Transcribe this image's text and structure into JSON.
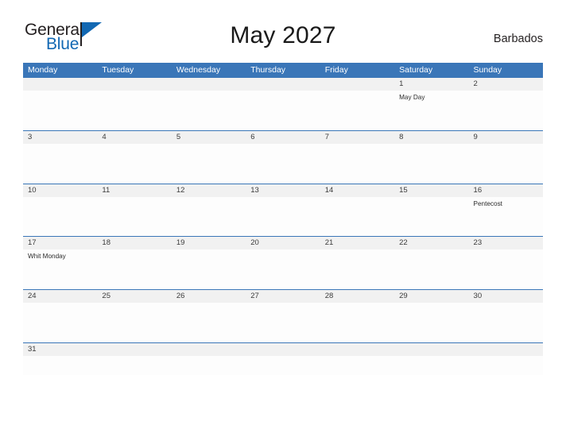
{
  "brand": {
    "name_top": "General",
    "name_bottom": "Blue",
    "flag_icon": "flag-triangle-icon",
    "color_primary": "#1268b3",
    "color_text": "#231f20"
  },
  "header": {
    "title": "May 2027",
    "country": "Barbados"
  },
  "calendar": {
    "header_bg": "#3a76b8",
    "date_strip_bg": "#f1f1f1",
    "rule_color": "#3a76b8",
    "weekday_headers": [
      "Monday",
      "Tuesday",
      "Wednesday",
      "Thursday",
      "Friday",
      "Saturday",
      "Sunday"
    ],
    "weeks": [
      {
        "days": [
          {
            "date": "",
            "event": ""
          },
          {
            "date": "",
            "event": ""
          },
          {
            "date": "",
            "event": ""
          },
          {
            "date": "",
            "event": ""
          },
          {
            "date": "",
            "event": ""
          },
          {
            "date": "1",
            "event": "May Day"
          },
          {
            "date": "2",
            "event": ""
          }
        ]
      },
      {
        "days": [
          {
            "date": "3",
            "event": ""
          },
          {
            "date": "4",
            "event": ""
          },
          {
            "date": "5",
            "event": ""
          },
          {
            "date": "6",
            "event": ""
          },
          {
            "date": "7",
            "event": ""
          },
          {
            "date": "8",
            "event": ""
          },
          {
            "date": "9",
            "event": ""
          }
        ]
      },
      {
        "days": [
          {
            "date": "10",
            "event": ""
          },
          {
            "date": "11",
            "event": ""
          },
          {
            "date": "12",
            "event": ""
          },
          {
            "date": "13",
            "event": ""
          },
          {
            "date": "14",
            "event": ""
          },
          {
            "date": "15",
            "event": ""
          },
          {
            "date": "16",
            "event": "Pentecost"
          }
        ]
      },
      {
        "days": [
          {
            "date": "17",
            "event": "Whit Monday"
          },
          {
            "date": "18",
            "event": ""
          },
          {
            "date": "19",
            "event": ""
          },
          {
            "date": "20",
            "event": ""
          },
          {
            "date": "21",
            "event": ""
          },
          {
            "date": "22",
            "event": ""
          },
          {
            "date": "23",
            "event": ""
          }
        ]
      },
      {
        "days": [
          {
            "date": "24",
            "event": ""
          },
          {
            "date": "25",
            "event": ""
          },
          {
            "date": "26",
            "event": ""
          },
          {
            "date": "27",
            "event": ""
          },
          {
            "date": "28",
            "event": ""
          },
          {
            "date": "29",
            "event": ""
          },
          {
            "date": "30",
            "event": ""
          }
        ]
      },
      {
        "days": [
          {
            "date": "31",
            "event": ""
          },
          {
            "date": "",
            "event": ""
          },
          {
            "date": "",
            "event": ""
          },
          {
            "date": "",
            "event": ""
          },
          {
            "date": "",
            "event": ""
          },
          {
            "date": "",
            "event": ""
          },
          {
            "date": "",
            "event": ""
          }
        ]
      }
    ]
  }
}
